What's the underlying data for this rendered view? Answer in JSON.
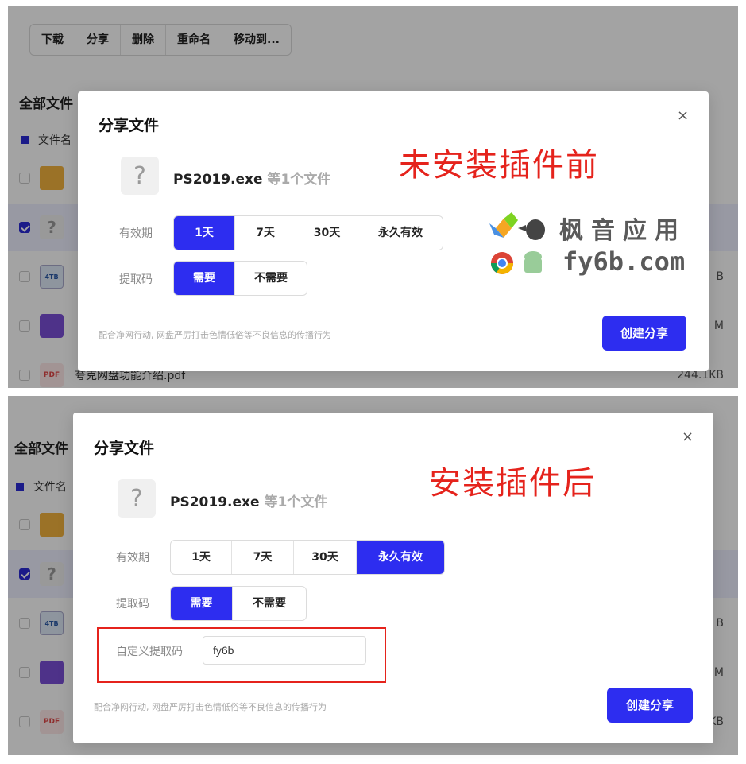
{
  "toolbar": {
    "download": "下载",
    "share": "分享",
    "delete": "删除",
    "rename": "重命名",
    "move_to": "移动到..."
  },
  "list": {
    "section_title": "全部文件",
    "col_filename": "文件名",
    "pdf_name": "夸克网盘功能介绍.pdf",
    "pdf_size": "244.1KB",
    "size_partial_b": "B",
    "size_partial_m": "M",
    "size_partial_kb": "KB"
  },
  "icons": {
    "pdf_label": "PDF",
    "tb_label": "4TB",
    "unknown_glyph": "?"
  },
  "modal_before": {
    "title": "分享文件",
    "close": "×",
    "file_name": "PS2019.exe",
    "file_count": "等1个文件",
    "validity_label": "有效期",
    "validity_options": [
      "1天",
      "7天",
      "30天",
      "永久有效"
    ],
    "validity_selected": "1天",
    "code_label": "提取码",
    "code_options": [
      "需要",
      "不需要"
    ],
    "code_selected": "需要",
    "note": "配合净网行动, 网盘严厉打击色情低俗等不良信息的传播行为",
    "create_button": "创建分享",
    "annotation": "未安装插件前"
  },
  "modal_after": {
    "title": "分享文件",
    "close": "×",
    "file_name": "PS2019.exe",
    "file_count": "等1个文件",
    "validity_label": "有效期",
    "validity_options": [
      "1天",
      "7天",
      "30天",
      "永久有效"
    ],
    "validity_selected": "永久有效",
    "code_label": "提取码",
    "code_options": [
      "需要",
      "不需要"
    ],
    "code_selected": "需要",
    "custom_code_label": "自定义提取码",
    "custom_code_value": "fy6b",
    "note": "配合净网行动, 网盘严厉打击色情低俗等不良信息的传播行为",
    "create_button": "创建分享",
    "annotation": "安装插件后"
  },
  "watermark": {
    "line1": "枫音应用",
    "line2": "fy6b.com"
  },
  "colors": {
    "primary": "#2d2df0",
    "annotation": "#e5231c"
  }
}
